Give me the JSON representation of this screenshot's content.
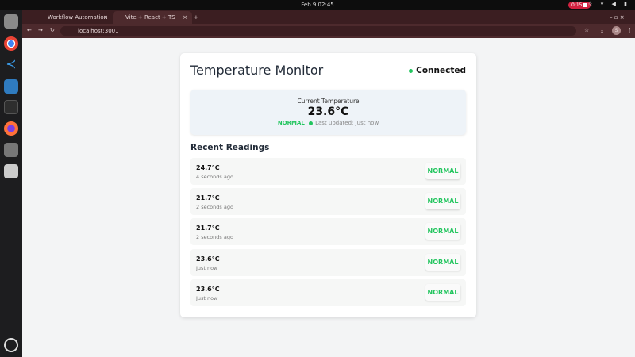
{
  "system": {
    "clock": "Feb 9  02:45",
    "recording": "0:15"
  },
  "browser": {
    "tabs": [
      {
        "label": "Workflow Automation ·"
      },
      {
        "label": "Vite + React + TS",
        "active": true
      }
    ],
    "url": "localhost:3001",
    "profile_initial": "S"
  },
  "app": {
    "title": "Temperature Monitor",
    "connection": "Connected",
    "current": {
      "label": "Current Temperature",
      "value": "23.6°C",
      "status": "NORMAL",
      "updated": "Last updated: Just now"
    },
    "recent_title": "Recent Readings",
    "readings": [
      {
        "temp": "24.7°C",
        "ago": "4 seconds ago",
        "status": "NORMAL"
      },
      {
        "temp": "21.7°C",
        "ago": "2 seconds ago",
        "status": "NORMAL"
      },
      {
        "temp": "21.7°C",
        "ago": "2 seconds ago",
        "status": "NORMAL"
      },
      {
        "temp": "23.6°C",
        "ago": "Just now",
        "status": "NORMAL"
      },
      {
        "temp": "23.6°C",
        "ago": "Just now",
        "status": "NORMAL"
      }
    ]
  },
  "colors": {
    "accent_green": "#22c55e",
    "browser_frame": "#3b1e21"
  }
}
